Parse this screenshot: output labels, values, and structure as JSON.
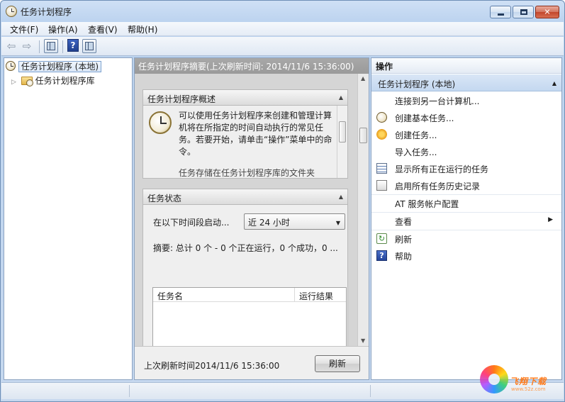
{
  "window": {
    "title": "任务计划程序"
  },
  "menu": [
    "文件(F)",
    "操作(A)",
    "查看(V)",
    "帮助(H)"
  ],
  "tree": {
    "root": "任务计划程序 (本地)",
    "library": "任务计划程序库"
  },
  "main": {
    "header": "任务计划程序摘要(上次刷新时间: 2014/11/6 15:36:00)",
    "overview": {
      "title": "任务计划程序概述",
      "text": "可以使用任务计划程序来创建和管理计算机将在所指定的时间自动执行的常见任务。若要开始，请单击“操作”菜单中的命令。",
      "text2": "任务存储在任务计划程序库的文件夹"
    },
    "status": {
      "title": "任务状态",
      "range_label": "在以下时间段启动...",
      "range_value": "近 24 小时",
      "summary": "摘要: 总计 0 个 - 0 个正在运行，0 个成功，0 ...",
      "columns": [
        "任务名",
        "运行结果"
      ]
    },
    "footer": {
      "last_refresh": "上次刷新时间2014/11/6 15:36:00",
      "refresh_button": "刷新"
    }
  },
  "actions": {
    "title": "操作",
    "group": "任务计划程序 (本地)",
    "items": [
      {
        "label": "连接到另一台计算机...",
        "icon": "none"
      },
      {
        "label": "创建基本任务...",
        "icon": "clock-icon"
      },
      {
        "label": "创建任务...",
        "icon": "star-icon"
      },
      {
        "label": "导入任务...",
        "icon": "none"
      },
      {
        "label": "显示所有正在运行的任务",
        "icon": "list-icon"
      },
      {
        "label": "启用所有任务历史记录",
        "icon": "document-icon"
      },
      {
        "label": "AT 服务帐户配置",
        "icon": "none"
      },
      {
        "label": "查看",
        "icon": "none"
      },
      {
        "label": "刷新",
        "icon": "refresh-icon"
      },
      {
        "label": "帮助",
        "icon": "help-icon"
      }
    ]
  },
  "watermark": {
    "text": "飞翔下载",
    "sub": "www.52z.com"
  },
  "colors": {
    "mid_header": "#9e9e9e",
    "actions_group": "#c9daf1",
    "title_bar": "#c7daf2"
  }
}
